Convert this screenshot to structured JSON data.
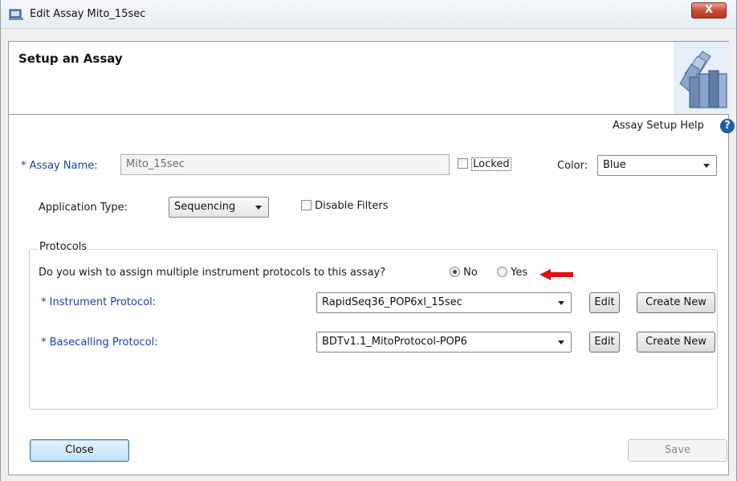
{
  "window": {
    "title": "Edit Assay Mito_15sec",
    "close_glyph": "X"
  },
  "header": {
    "title": "Setup an Assay"
  },
  "help": {
    "label": "Assay Setup Help",
    "icon_glyph": "?"
  },
  "assay_name": {
    "label": "Assay Name:",
    "required_marker": "*",
    "value": "Mito_15sec"
  },
  "locked": {
    "label": "Locked",
    "checked": false
  },
  "color": {
    "label": "Color:",
    "selected": "Blue"
  },
  "application_type": {
    "label": "Application Type:",
    "selected": "Sequencing"
  },
  "disable_filters": {
    "label": "Disable Filters",
    "checked": false
  },
  "protocols": {
    "legend": "Protocols",
    "question": "Do you wish to assign multiple instrument protocols to this assay?",
    "option_no": "No",
    "option_yes": "Yes",
    "selected": "No",
    "instrument": {
      "label": "Instrument Protocol:",
      "required_marker": "*",
      "selected": "RapidSeq36_POP6xl_15sec",
      "edit_label": "Edit",
      "create_label": "Create New"
    },
    "basecalling": {
      "label": "Basecalling Protocol:",
      "required_marker": "*",
      "selected": "BDTv1.1_MitoProtocol-POP6",
      "edit_label": "Edit",
      "create_label": "Create New"
    }
  },
  "footer": {
    "close_label": "Close",
    "save_label": "Save"
  },
  "colors": {
    "accent_blue": "#1a3fb5",
    "annotation_arrow": "#e01010"
  }
}
